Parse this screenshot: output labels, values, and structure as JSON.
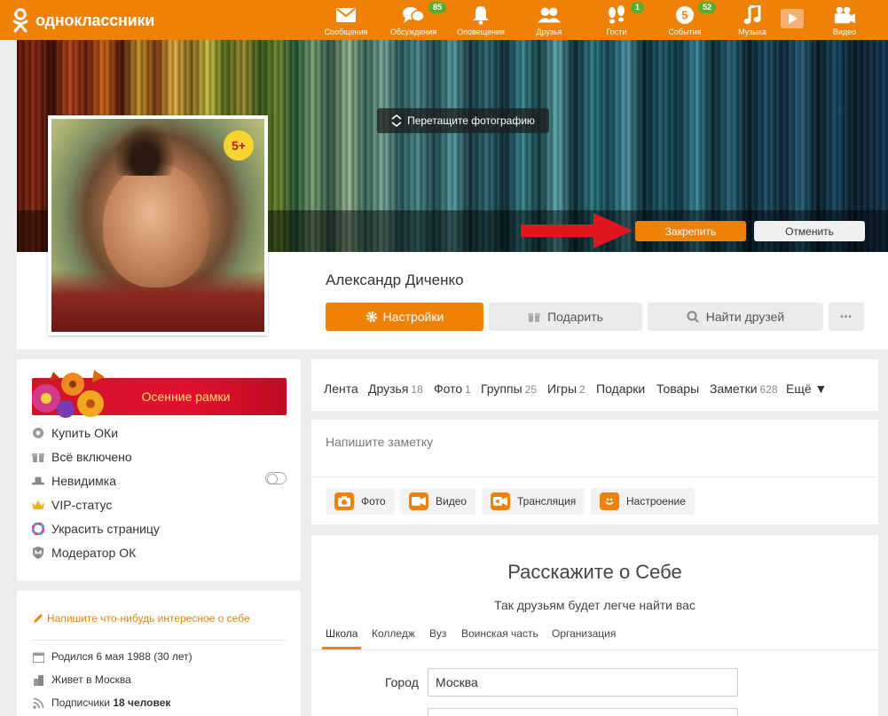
{
  "app": {
    "logo_text": "одноклассники"
  },
  "nav": [
    {
      "label": "Сообщения",
      "icon": "envelope-icon",
      "badge": ""
    },
    {
      "label": "Обсуждения",
      "icon": "chat-icon",
      "badge": "85"
    },
    {
      "label": "Оповещения",
      "icon": "bell-icon",
      "badge": ""
    },
    {
      "label": "Друзья",
      "icon": "friends-icon",
      "badge": ""
    },
    {
      "label": "Гости",
      "icon": "footprints-icon",
      "badge": "1"
    },
    {
      "label": "События",
      "icon": "events-icon",
      "badge": "52"
    },
    {
      "label": "Музыка",
      "icon": "music-note-icon",
      "badge": ""
    },
    {
      "label": "Видео",
      "icon": "video-camera-icon",
      "badge": ""
    }
  ],
  "cover": {
    "drag_hint": "Перетащите фотографию",
    "pin_label": "Закрепить",
    "cancel_label": "Отменить"
  },
  "profile": {
    "name": "Александр Диченко",
    "age_badge": "5+",
    "settings_label": "Настройки",
    "gift_label": "Подарить",
    "find_friends_label": "Найти друзей",
    "more_label": "•••"
  },
  "left_menu": {
    "promo": "Осенние рамки",
    "items": [
      {
        "label": "Купить ОКи",
        "icon": "coins-icon"
      },
      {
        "label": "Всё включено",
        "icon": "gift-icon"
      },
      {
        "label": "Невидимка",
        "icon": "hat-icon"
      },
      {
        "label": "VIP-статус",
        "icon": "crown-icon"
      },
      {
        "label": "Украсить страницу",
        "icon": "palette-icon"
      },
      {
        "label": "Модератор ОК",
        "icon": "shield-icon"
      }
    ]
  },
  "about_box": {
    "prompt": "Напишите что-нибудь интересное о себе",
    "rows": [
      {
        "text": "Родился 6 мая 1988 (30 лет)",
        "bold": "",
        "icon": "calendar-icon"
      },
      {
        "text": "Живет в Москва",
        "bold": "",
        "icon": "location-icon"
      },
      {
        "text": "Подписчики ",
        "bold": "18 человек",
        "icon": "rss-icon"
      }
    ]
  },
  "tabs": [
    {
      "label": "Лента",
      "count": ""
    },
    {
      "label": "Друзья",
      "count": "18"
    },
    {
      "label": "Фото",
      "count": "1"
    },
    {
      "label": "Группы",
      "count": "25"
    },
    {
      "label": "Игры",
      "count": "2"
    },
    {
      "label": "Подарки",
      "count": ""
    },
    {
      "label": "Товары",
      "count": ""
    },
    {
      "label": "Заметки",
      "count": "628"
    },
    {
      "label": "Ещё ▼",
      "count": ""
    }
  ],
  "note": {
    "placeholder": "Напишите заметку",
    "chips": [
      {
        "label": "Фото",
        "icon": "camera-icon"
      },
      {
        "label": "Видео",
        "icon": "video-icon"
      },
      {
        "label": "Трансляция",
        "icon": "broadcast-icon"
      },
      {
        "label": "Настроение",
        "icon": "smile-icon"
      }
    ]
  },
  "about_form": {
    "title": "Расскажите о Себе",
    "subtitle": "Так друзьям будет легче найти вас",
    "tabs": [
      "Школа",
      "Колледж",
      "Вуз",
      "Воинская часть",
      "Организация"
    ],
    "city_label": "Город",
    "city_value": "Москва"
  },
  "colors": {
    "brand": "#ee8208",
    "badge": "#5aac2e",
    "promo": "#d01428"
  }
}
